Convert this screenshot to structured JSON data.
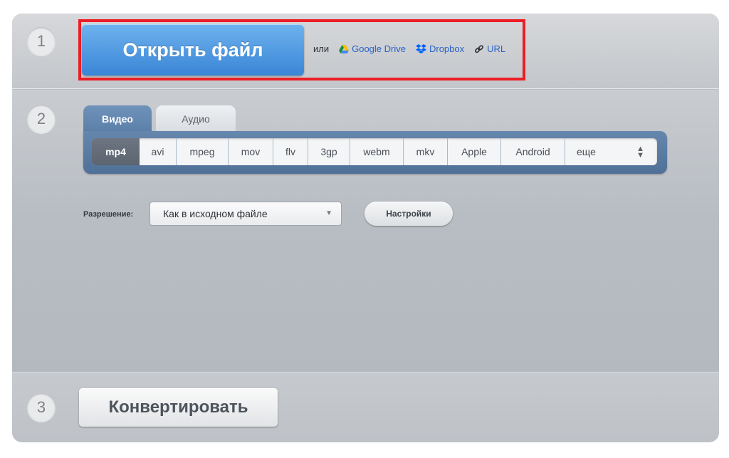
{
  "steps": {
    "one": "1",
    "two": "2",
    "three": "3"
  },
  "step1": {
    "open_file_label": "Открыть файл",
    "or_label": "или",
    "google_drive_label": "Google Drive",
    "dropbox_label": "Dropbox",
    "url_label": "URL",
    "highlight_color": "#ec1d25"
  },
  "step2": {
    "tabs": [
      {
        "label": "Видео",
        "active": true
      },
      {
        "label": "Аудио",
        "active": false
      }
    ],
    "formats": [
      "mp4",
      "avi",
      "mpeg",
      "mov",
      "flv",
      "3gp",
      "webm",
      "mkv",
      "Apple",
      "Android"
    ],
    "selected_format": "mp4",
    "more_label": "еще",
    "resolution_label": "Разрешение:",
    "resolution_value": "Как в исходном файле",
    "settings_label": "Настройки"
  },
  "step3": {
    "convert_label": "Конвертировать"
  },
  "colors": {
    "primary_blue": "#3a85d6",
    "link": "#2a63c7",
    "tab_blue": "#5a7fa7"
  },
  "icons": [
    "google-drive-icon",
    "dropbox-icon",
    "link-icon",
    "dropdown-caret-icon",
    "sort-arrows-icon"
  ]
}
